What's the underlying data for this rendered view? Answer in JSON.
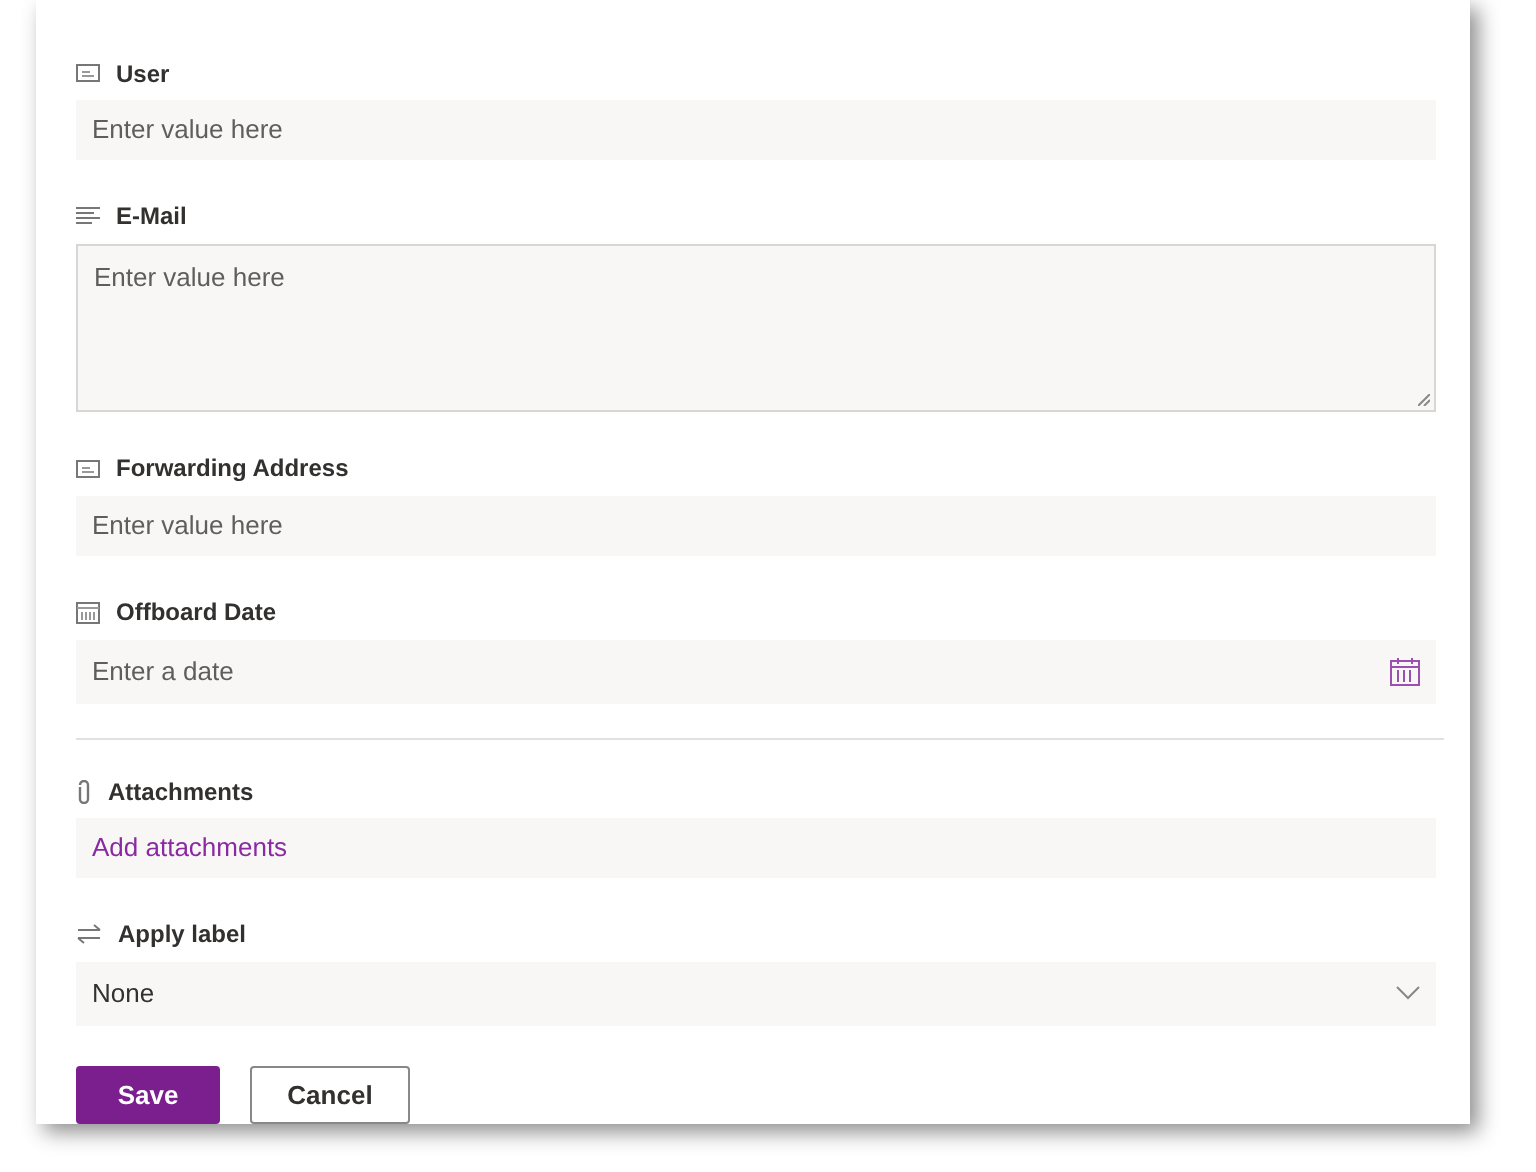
{
  "fields": [
    {
      "kind": "text",
      "label": "User",
      "placeholder": "Enter value here"
    },
    {
      "kind": "multiline",
      "label": "E-Mail",
      "placeholder": "Enter value here"
    },
    {
      "kind": "text",
      "label": "Forwarding Address",
      "placeholder": "Enter value here"
    },
    {
      "kind": "date",
      "label": "Offboard Date",
      "placeholder": "Enter a date"
    },
    {
      "kind": "divider"
    },
    {
      "kind": "attachments",
      "label": "Attachments",
      "link": "Add attachments"
    },
    {
      "kind": "choice",
      "label": "Apply label",
      "value": "None"
    }
  ],
  "buttons": [
    {
      "label": "Save",
      "primary": true
    },
    {
      "label": "Cancel",
      "primary": false
    }
  ]
}
